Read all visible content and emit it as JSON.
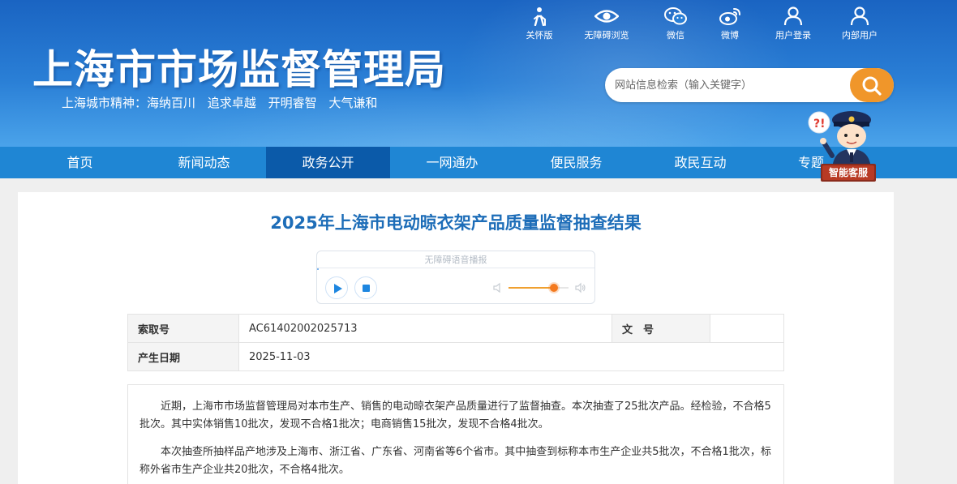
{
  "header": {
    "title": "上海市市场监督管理局",
    "city_spirit": [
      "上海城市精神：海纳百川",
      "追求卓越",
      "开明睿智",
      "大气谦和"
    ]
  },
  "top_tools": [
    {
      "label": "关怀版",
      "icon": "elderly-care-icon"
    },
    {
      "label": "无障碍浏览",
      "icon": "eye-icon"
    },
    {
      "label": "微信",
      "icon": "wechat-icon"
    },
    {
      "label": "微博",
      "icon": "weibo-icon"
    },
    {
      "label": "用户登录",
      "icon": "user-icon"
    },
    {
      "label": "内部用户",
      "icon": "user-icon"
    }
  ],
  "search": {
    "placeholder": "网站信息检索（输入关键字）",
    "button_icon": "search-icon"
  },
  "nav": {
    "items": [
      "首页",
      "新闻动态",
      "政务公开",
      "一网通办",
      "便民服务",
      "政民互动",
      "专题"
    ],
    "active": "政务公开"
  },
  "assistant": {
    "label": "智能客服",
    "bubble": "?!"
  },
  "article": {
    "title": "2025年上海市电动晾衣架产品质量监督抽查结果",
    "audio": {
      "label": "无障碍语音播报",
      "volume": 0.75
    },
    "meta": {
      "index_label": "索取号",
      "index_value": "AC61402002025713",
      "doc_label": "文　号",
      "doc_value": "",
      "date_label": "产生日期",
      "date_value": "2025-11-03"
    },
    "paragraphs": [
      "近期，上海市市场监督管理局对本市生产、销售的电动晾衣架产品质量进行了监督抽查。本次抽查了25批次产品。经检验，不合格5批次。其中实体销售10批次，发现不合格1批次；电商销售15批次，发现不合格4批次。",
      "本次抽查所抽样品产地涉及上海市、浙江省、广东省、河南省等6个省市。其中抽查到标称本市生产企业共5批次，不合格1批次，标称外省市生产企业共20批次，不合格4批次。"
    ]
  },
  "colors": {
    "header_blue": "#1a64c2",
    "nav_blue": "#1f86d4",
    "nav_active": "#0b5aa9",
    "title_blue": "#1d6db8",
    "search_orange": "#f0962a"
  }
}
